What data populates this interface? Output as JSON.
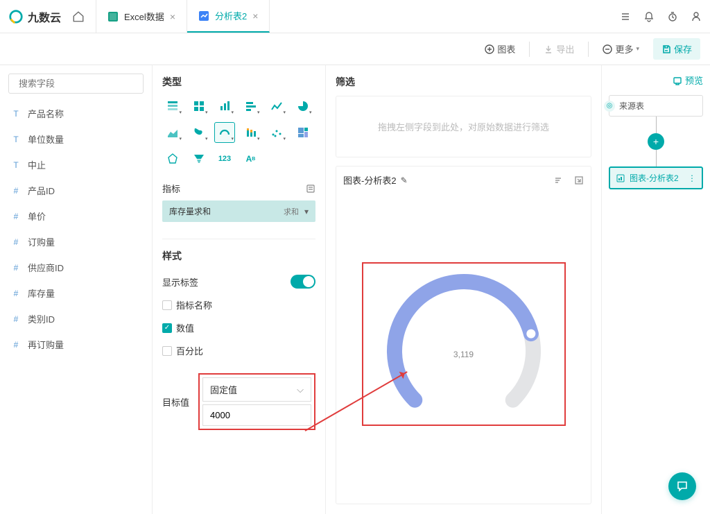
{
  "brand": "九数云",
  "tabs": [
    {
      "label": "Excel数据",
      "active": false,
      "icon_color": "#16a085"
    },
    {
      "label": "分析表2",
      "active": true,
      "icon_color": "#0a84ff"
    }
  ],
  "toolbar": {
    "chart": "图表",
    "export": "导出",
    "more": "更多",
    "save": "保存"
  },
  "left": {
    "search_placeholder": "搜索字段",
    "fields": [
      {
        "type": "T",
        "label": "产品名称"
      },
      {
        "type": "T",
        "label": "单位数量"
      },
      {
        "type": "T",
        "label": "中止"
      },
      {
        "type": "#",
        "label": "产品ID"
      },
      {
        "type": "#",
        "label": "单价"
      },
      {
        "type": "#",
        "label": "订购量"
      },
      {
        "type": "#",
        "label": "供应商ID"
      },
      {
        "type": "#",
        "label": "库存量"
      },
      {
        "type": "#",
        "label": "类别ID"
      },
      {
        "type": "#",
        "label": "再订购量"
      }
    ]
  },
  "config": {
    "type_label": "类型",
    "metric_label": "指标",
    "metric_pill": "库存量求和",
    "metric_agg": "求和",
    "style_label": "样式",
    "show_label": "显示标签",
    "cb_metric_name": "指标名称",
    "cb_value": "数值",
    "cb_percent": "百分比",
    "target_label": "目标值",
    "target_mode": "固定值",
    "target_value": "4000"
  },
  "chart": {
    "filter_label": "筛选",
    "filter_placeholder": "拖拽左侧字段到此处，对原始数据进行筛选",
    "title": "图表-分析表2"
  },
  "right": {
    "preview": "预览",
    "source": "来源表",
    "chart_node": "图表-分析表2"
  },
  "chart_data": {
    "type": "gauge",
    "value": 3119,
    "value_display": "3,119",
    "target": 4000,
    "percent": 0.78,
    "arc_color": "#8fa4e8",
    "remaining_color": "#e3e4e6"
  }
}
